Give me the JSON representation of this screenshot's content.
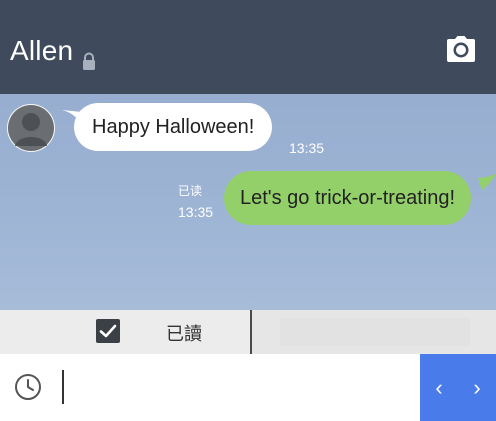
{
  "header": {
    "title": "Allen",
    "lock_icon": "lock-icon",
    "camera_icon": "camera-icon",
    "background": "#3f4a5c"
  },
  "chat": {
    "background": "#9cb2d3",
    "messages": [
      {
        "direction": "incoming",
        "text": "Happy Halloween!",
        "time": "13:35",
        "bubble_color": "#ffffff"
      },
      {
        "direction": "outgoing",
        "text": "Let's go trick-or-treating!",
        "time": "13:35",
        "read_label": "已读",
        "bubble_color": "#93d06a"
      }
    ]
  },
  "read_bar": {
    "checked": true,
    "label": "已讀"
  },
  "input_bar": {
    "clock_icon": "clock-icon",
    "value": "",
    "nav_prev": "‹",
    "nav_next": "›",
    "nav_color": "#4a7bea"
  }
}
